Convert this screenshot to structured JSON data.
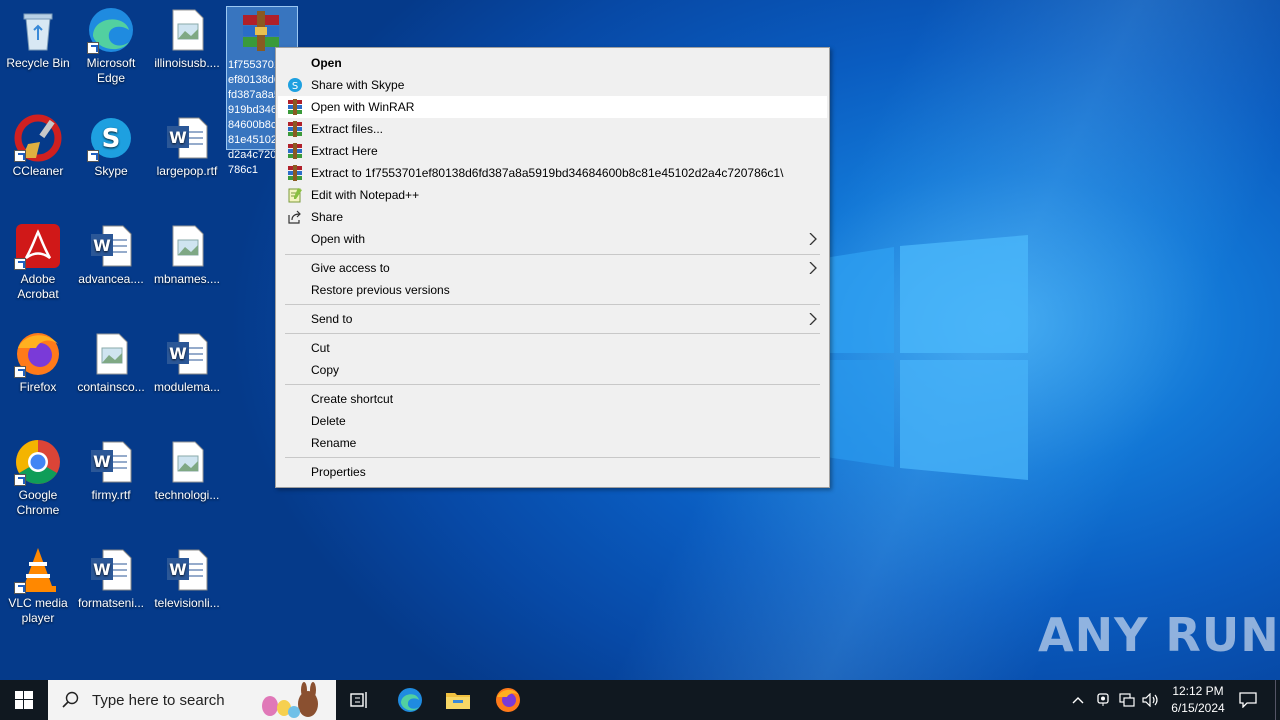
{
  "desktop": {
    "icons": [
      {
        "label": "Recycle Bin",
        "icon": "recycle-bin-icon"
      },
      {
        "label": "Microsoft Edge",
        "icon": "edge-icon"
      },
      {
        "label": "illinoisusb....",
        "icon": "image-file-icon"
      },
      {
        "label": "CCleaner",
        "icon": "ccleaner-icon"
      },
      {
        "label": "Skype",
        "icon": "skype-icon"
      },
      {
        "label": "largepop.rtf",
        "icon": "word-doc-icon"
      },
      {
        "label": "Adobe Acrobat",
        "icon": "acrobat-icon"
      },
      {
        "label": "advancea....",
        "icon": "word-doc-icon"
      },
      {
        "label": "mbnames....",
        "icon": "image-file-icon"
      },
      {
        "label": "Firefox",
        "icon": "firefox-icon"
      },
      {
        "label": "containsco...",
        "icon": "image-file-icon"
      },
      {
        "label": "modulema...",
        "icon": "word-doc-icon"
      },
      {
        "label": "Google Chrome",
        "icon": "chrome-icon"
      },
      {
        "label": "firmy.rtf",
        "icon": "word-doc-icon"
      },
      {
        "label": "technologi...",
        "icon": "image-file-icon"
      },
      {
        "label": "VLC media player",
        "icon": "vlc-icon"
      },
      {
        "label": "formatseni...",
        "icon": "word-doc-icon"
      },
      {
        "label": "televisionli...",
        "icon": "word-doc-icon"
      }
    ],
    "selected_file_label": "1f7553701ef80138d6fd387a8a5919bd34684600b8c81e45102d2a4c720786c1"
  },
  "context_menu": {
    "items": [
      {
        "label": "Open"
      },
      {
        "label": "Share with Skype"
      },
      {
        "label": "Open with WinRAR"
      },
      {
        "label": "Extract files..."
      },
      {
        "label": "Extract Here"
      },
      {
        "label": "Extract to 1f7553701ef80138d6fd387a8a5919bd34684600b8c81e45102d2a4c720786c1\\"
      },
      {
        "label": "Edit with Notepad++"
      },
      {
        "label": "Share"
      },
      {
        "label": "Open with"
      },
      {
        "label": "Give access to"
      },
      {
        "label": "Restore previous versions"
      },
      {
        "label": "Send to"
      },
      {
        "label": "Cut"
      },
      {
        "label": "Copy"
      },
      {
        "label": "Create shortcut"
      },
      {
        "label": "Delete"
      },
      {
        "label": "Rename"
      },
      {
        "label": "Properties"
      }
    ],
    "highlighted": "Open with WinRAR"
  },
  "taskbar": {
    "search_placeholder": "Type here to search",
    "time": "12:12 PM",
    "date": "6/15/2024",
    "pinned": [
      "task-view",
      "edge",
      "file-explorer",
      "firefox"
    ]
  },
  "watermark": "ANY RUN",
  "colors": {
    "menu_bg": "#f0f0f0",
    "taskbar_bg": "#101820",
    "highlight": "#ffffff"
  }
}
